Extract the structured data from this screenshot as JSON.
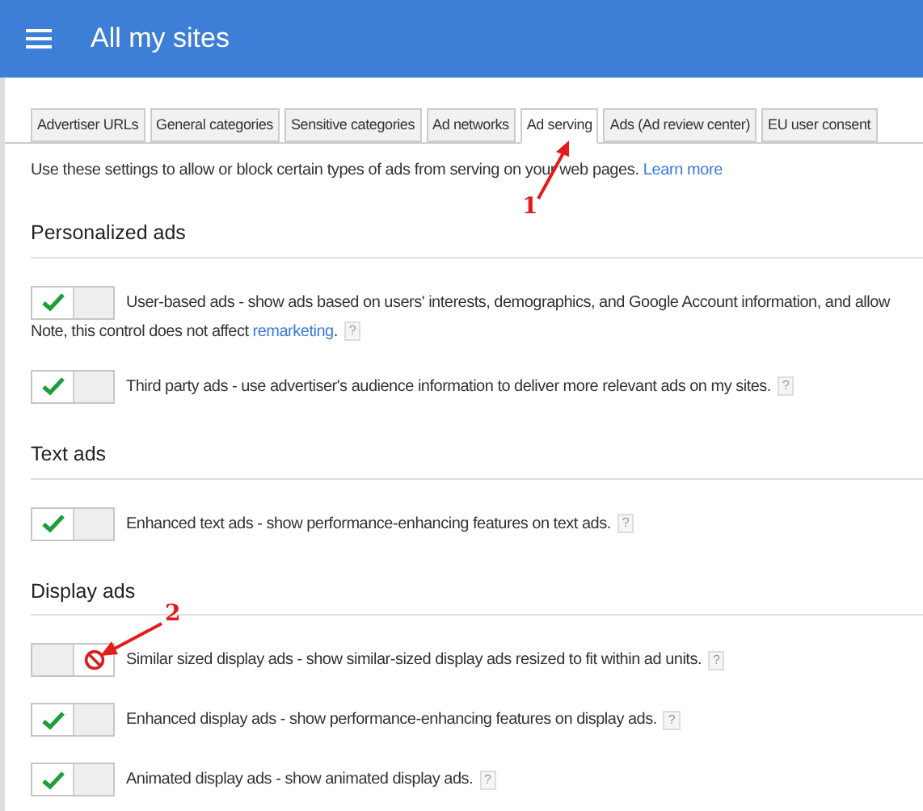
{
  "header": {
    "title": "All my sites"
  },
  "tabs": [
    {
      "label": "Advertiser URLs",
      "selected": false
    },
    {
      "label": "General categories",
      "selected": false
    },
    {
      "label": "Sensitive categories",
      "selected": false
    },
    {
      "label": "Ad networks",
      "selected": false
    },
    {
      "label": "Ad serving",
      "selected": true
    },
    {
      "label": "Ads (Ad review center)",
      "selected": false
    },
    {
      "label": "EU user consent",
      "selected": false
    }
  ],
  "intro": {
    "text": "Use these settings to allow or block certain types of ads from serving on your web pages.",
    "link": "Learn more"
  },
  "sections": [
    {
      "title": "Personalized ads",
      "rows": [
        {
          "on": true,
          "text": "User-based ads - show ads based on users' interests, demographics, and Google Account information, and allow",
          "note": "Note, this control does not affect",
          "link": "remarketing",
          "after_link": ".",
          "help": "?"
        },
        {
          "on": true,
          "text": "Third party ads - use advertiser's audience information to deliver more relevant ads on my sites.",
          "help": "?"
        }
      ]
    },
    {
      "title": "Text ads",
      "rows": [
        {
          "on": true,
          "text": "Enhanced text ads - show performance-enhancing features on text ads.",
          "help": "?"
        }
      ]
    },
    {
      "title": "Display ads",
      "rows": [
        {
          "on": false,
          "text": "Similar sized display ads - show similar-sized display ads resized to fit within ad units.",
          "help": "?"
        },
        {
          "on": true,
          "text": "Enhanced display ads - show performance-enhancing features on display ads.",
          "help": "?"
        },
        {
          "on": true,
          "text": "Animated display ads - show animated display ads.",
          "help": "?"
        }
      ]
    }
  ],
  "annotations": [
    {
      "label": "1"
    },
    {
      "label": "2"
    }
  ]
}
